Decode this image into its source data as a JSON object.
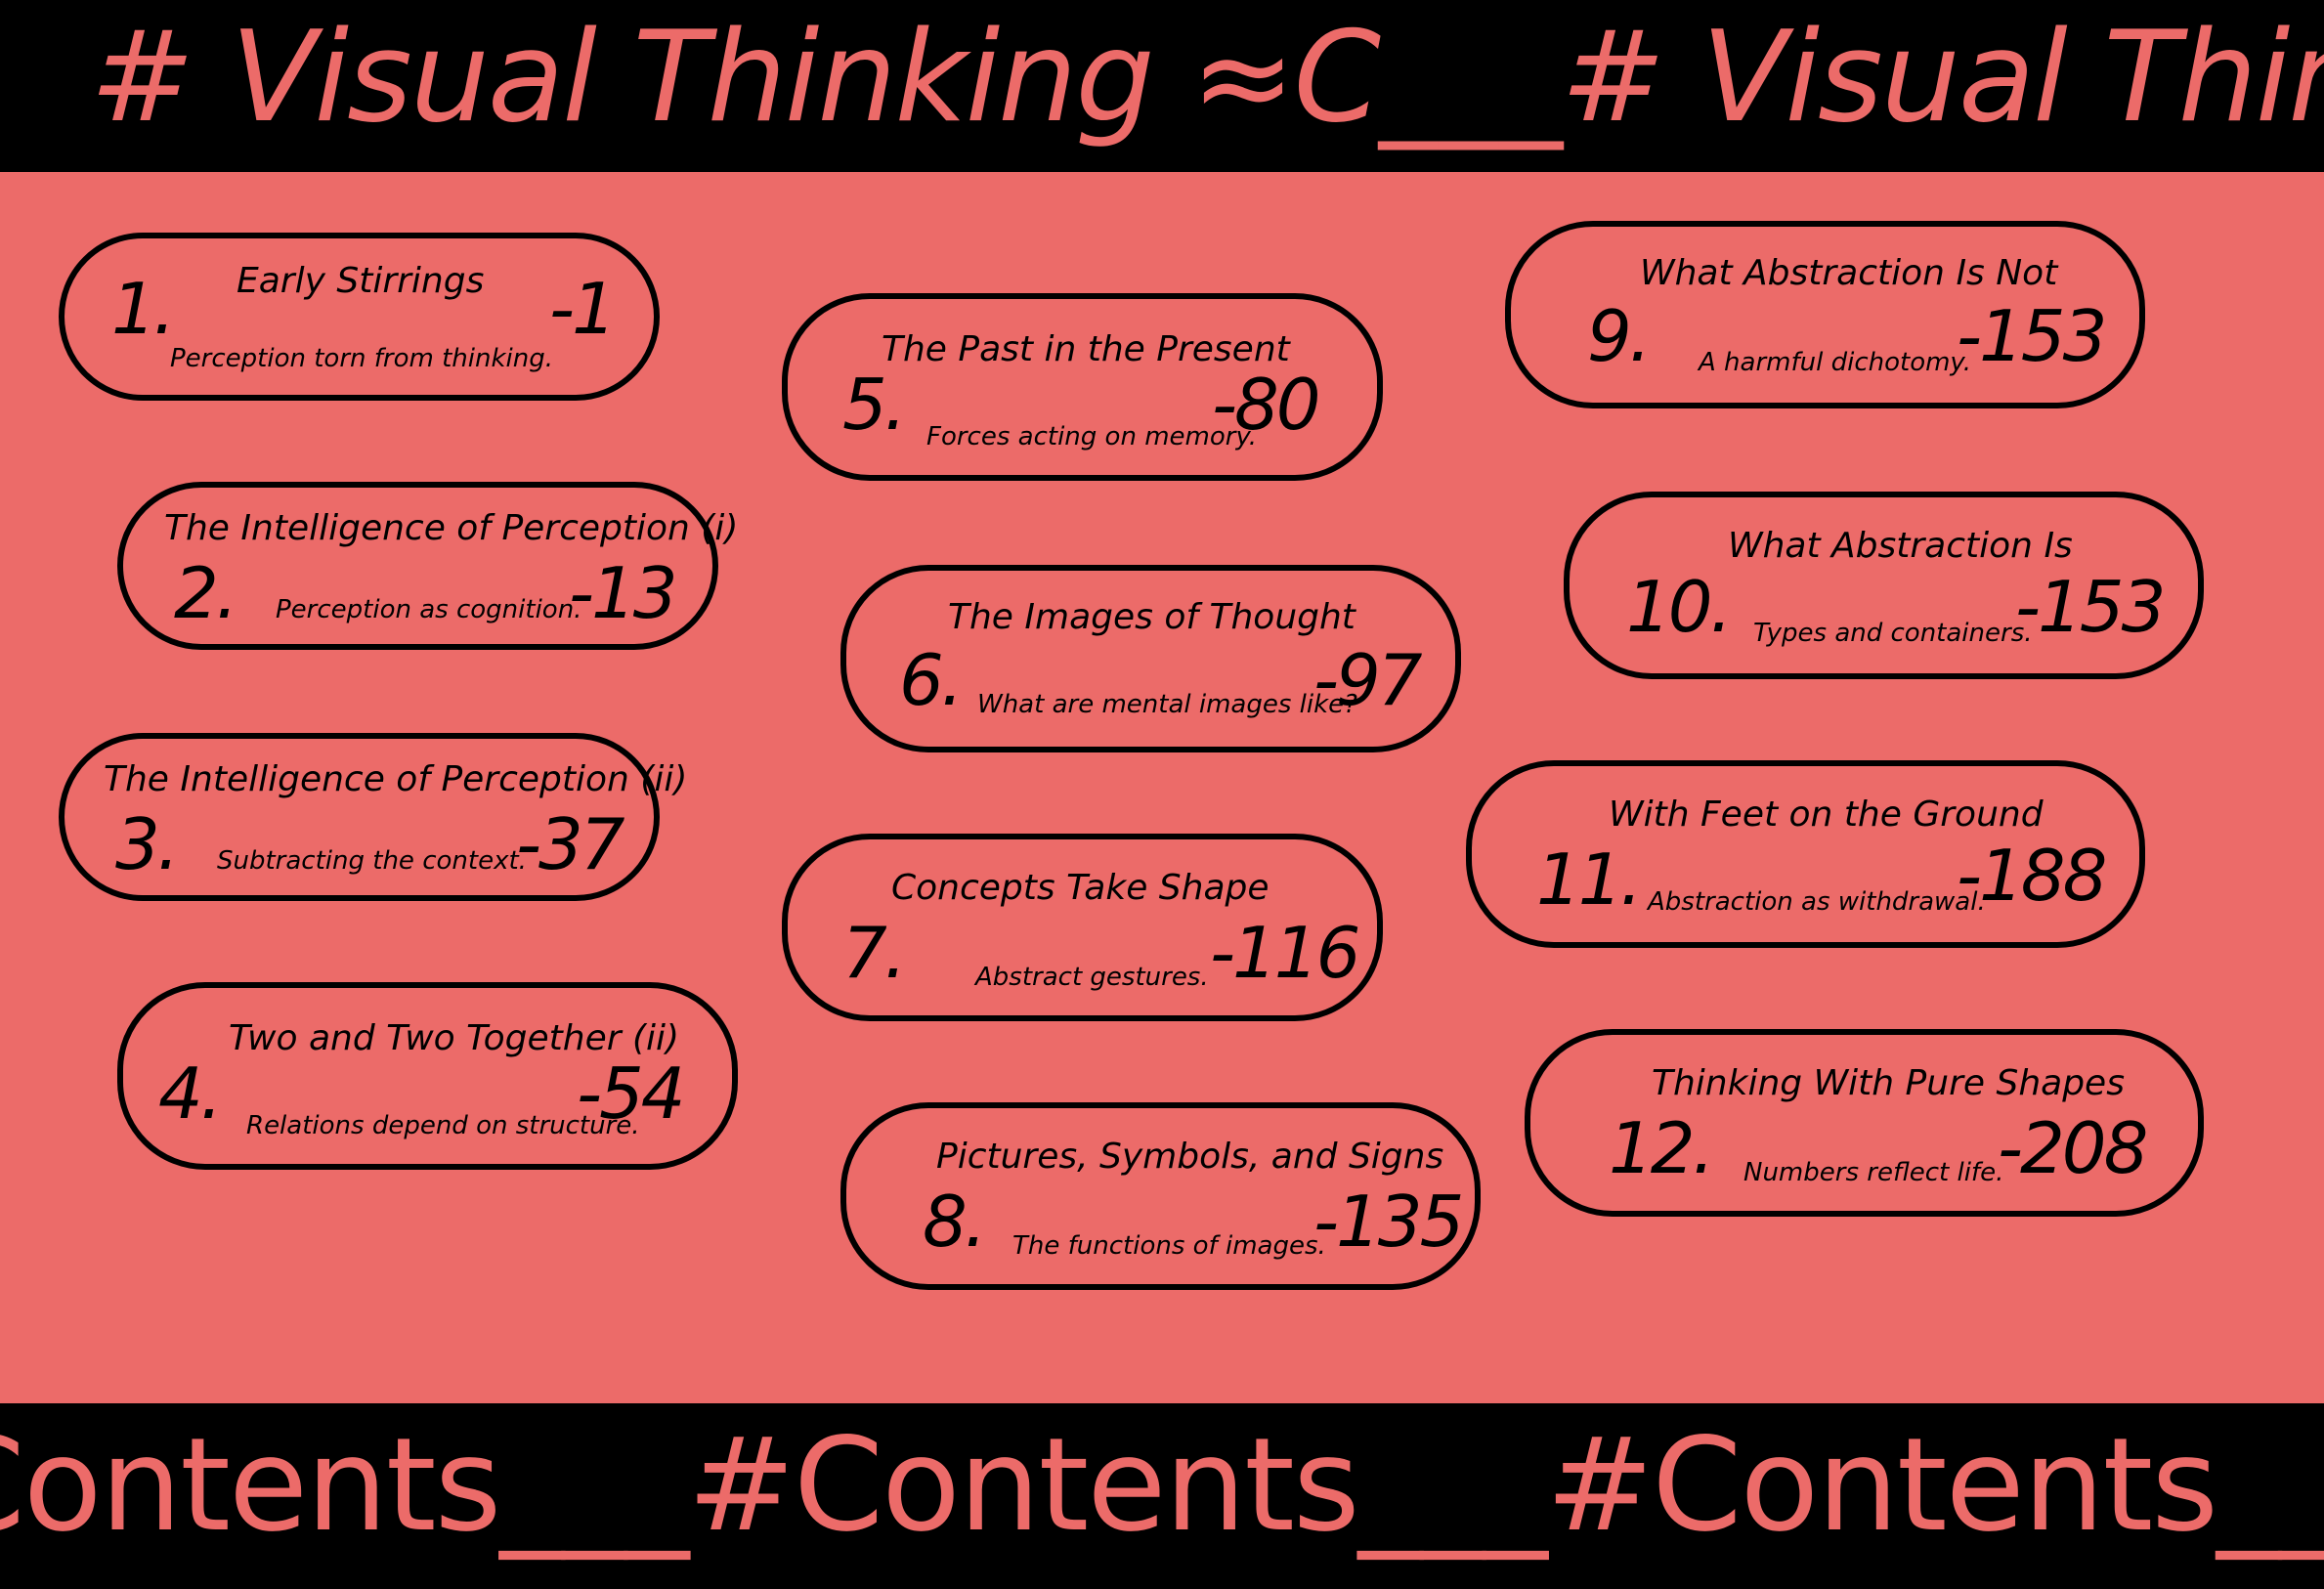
{
  "header": {
    "marquee_text": "# Visual Thinking ≈C___# Visual Thinking ≈C___"
  },
  "footer": {
    "marquee_text": "#Contents___#Contents___#Contents___#Contents___"
  },
  "colors": {
    "background": "#ec6b69",
    "band": "#000000",
    "ink": "#000000"
  },
  "chapters": [
    {
      "number": "1.",
      "title": "Early Stirrings",
      "subtitle": "Perception torn from thinking.",
      "page": "-1"
    },
    {
      "number": "2.",
      "title": "The Intelligence of Perception (i)",
      "subtitle": "Perception as cognition.",
      "page": "-13"
    },
    {
      "number": "3.",
      "title": "The Intelligence of Perception (ii)",
      "subtitle": "Subtracting the context.",
      "page": "-37"
    },
    {
      "number": "4.",
      "title": "Two and Two Together (ii)",
      "subtitle": "Relations depend on structure.",
      "page": "-54"
    },
    {
      "number": "5.",
      "title": "The Past in the Present",
      "subtitle": "Forces acting on memory.",
      "page": "-80"
    },
    {
      "number": "6.",
      "title": "The Images of Thought",
      "subtitle": "What are mental images like?",
      "page": "-97"
    },
    {
      "number": "7.",
      "title": "Concepts Take Shape",
      "subtitle": "Abstract gestures.",
      "page": "-116"
    },
    {
      "number": "8.",
      "title": "Pictures, Symbols, and Signs",
      "subtitle": "The functions of images.",
      "page": "-135"
    },
    {
      "number": "9.",
      "title": "What Abstraction Is Not",
      "subtitle": "A harmful dichotomy.",
      "page": "-153"
    },
    {
      "number": "10.",
      "title": "What Abstraction Is",
      "subtitle": "Types and containers.",
      "page": "-153"
    },
    {
      "number": "11.",
      "title": "With Feet on the Ground",
      "subtitle": "Abstraction as withdrawal.",
      "page": "-188"
    },
    {
      "number": "12.",
      "title": "Thinking With Pure Shapes",
      "subtitle": "Numbers reflect life.",
      "page": "-208"
    }
  ]
}
